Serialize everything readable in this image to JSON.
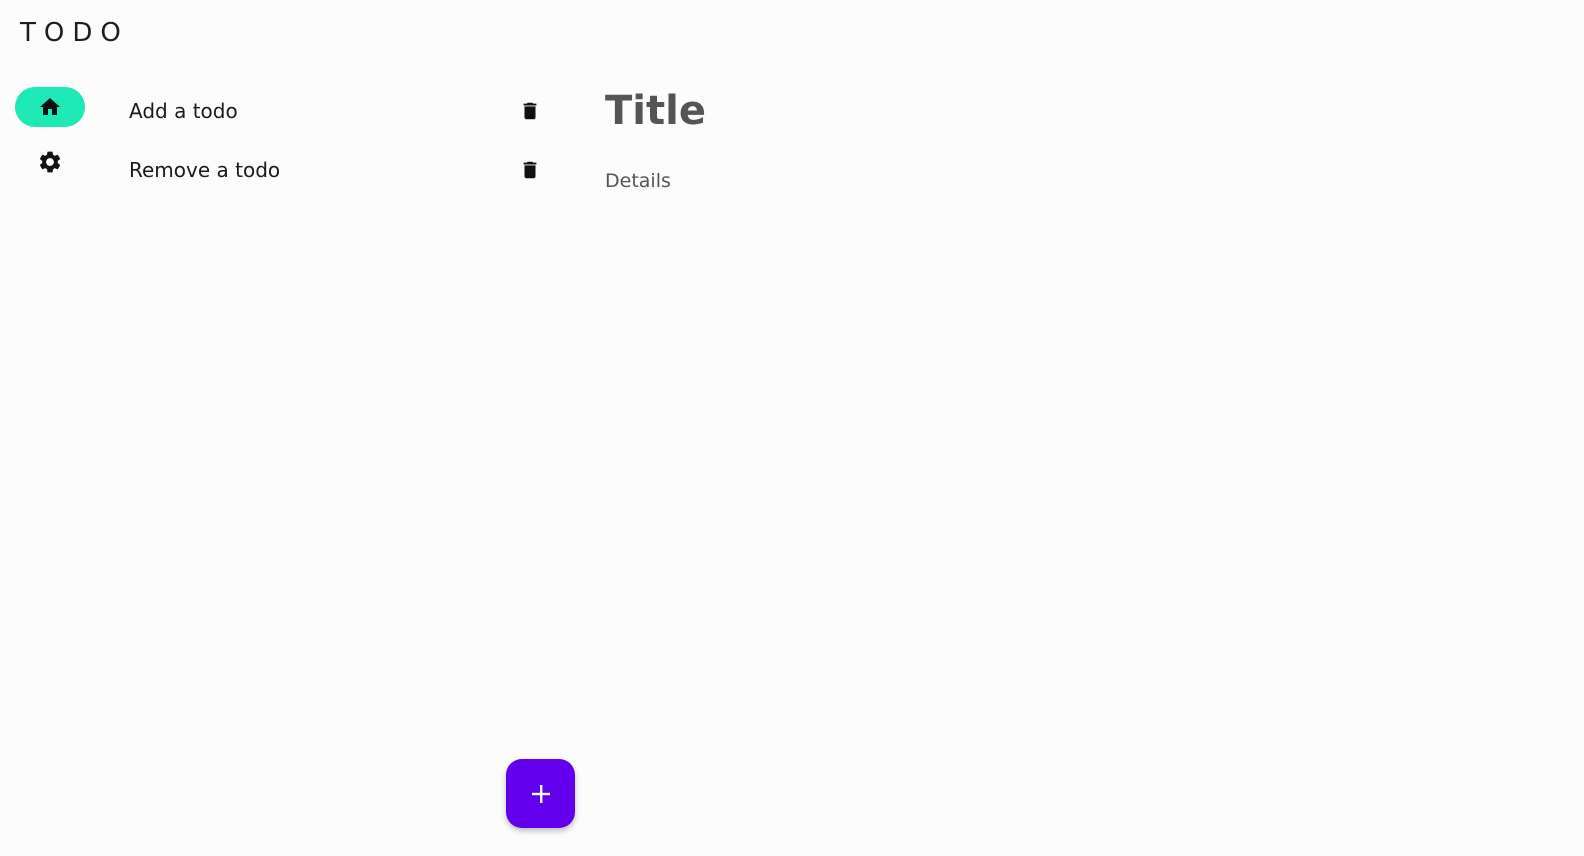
{
  "app": {
    "title": "TODO"
  },
  "navigation_rail": {
    "items": [
      {
        "icon": "home-icon",
        "active": true
      },
      {
        "icon": "gear-icon",
        "active": false
      }
    ]
  },
  "todo_list": {
    "items": [
      {
        "label": "Add a todo",
        "action_icon": "trash-icon"
      },
      {
        "label": "Remove a todo",
        "action_icon": "trash-icon"
      }
    ]
  },
  "detail": {
    "title": "Title",
    "body": "Details"
  },
  "fab": {
    "icon": "plus-icon"
  },
  "colors": {
    "rail_active": "#1de9b6",
    "fab_background": "#6200ee",
    "detail_text": "#555555",
    "background": "#fcfcfc"
  }
}
